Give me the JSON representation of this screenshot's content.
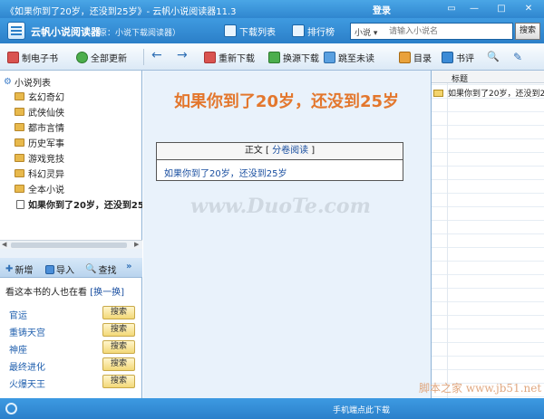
{
  "window": {
    "title": "《如果你到了20岁，还没到25岁》- 云帆小说阅读器11.3",
    "login": "登录",
    "controls": [
      "▭",
      "—",
      "□",
      "✕"
    ]
  },
  "header": {
    "app_name": "云帆小说阅读器",
    "app_sub": "（原：小说下载阅读器）",
    "nav": [
      {
        "label": "下载列表"
      },
      {
        "label": "排行榜"
      }
    ],
    "search": {
      "category": "小说 ▾",
      "placeholder": "请输入小说名",
      "button": "搜索"
    }
  },
  "toolbar": {
    "make_ebook": "制电子书",
    "update_all": "全部更新",
    "back": "←",
    "forward": "→",
    "redownload": "重新下载",
    "change_source": "换源下载",
    "jump_unread": "跳至未读",
    "catalog": "目录",
    "review": "书评",
    "find": "🔍",
    "pin": "✎"
  },
  "tree": {
    "root": "小说列表",
    "items": [
      {
        "label": "玄幻奇幻",
        "type": "folder"
      },
      {
        "label": "武侠仙侠",
        "type": "folder"
      },
      {
        "label": "都市言情",
        "type": "folder"
      },
      {
        "label": "历史军事",
        "type": "folder"
      },
      {
        "label": "游戏竞技",
        "type": "folder"
      },
      {
        "label": "科幻灵异",
        "type": "folder"
      },
      {
        "label": "全本小说",
        "type": "folder"
      },
      {
        "label": "如果你到了20岁，还没到25",
        "type": "book",
        "selected": true
      }
    ]
  },
  "left_toolbar": {
    "add": "新增",
    "import": "导入",
    "search": "查找",
    "more": "»"
  },
  "recommend": {
    "heading": "看这本书的人也在看",
    "switch": "[换一换]",
    "button_label": "搜索",
    "items": [
      "官运",
      "重铸天宫",
      "神座",
      "最终进化",
      "火爆天王"
    ]
  },
  "content": {
    "title": "如果你到了20岁，还没到25岁",
    "toc_prefix": "正文 [",
    "toc_link": "分卷阅读",
    "toc_suffix": "]",
    "chapter": "如果你到了20岁，还没到25岁"
  },
  "right_panel": {
    "column": "标题",
    "rows": [
      "如果你到了20岁，还没到25"
    ]
  },
  "status": {
    "mobile_download": "手机端点此下载"
  },
  "watermarks": {
    "center": "www.DuoTe.com",
    "corner": "脚本之家 www.jb51.net"
  },
  "colors": {
    "title_orange": "#e3772d",
    "frame_blue": "#2b80cb",
    "link_blue": "#1a4fa0"
  }
}
